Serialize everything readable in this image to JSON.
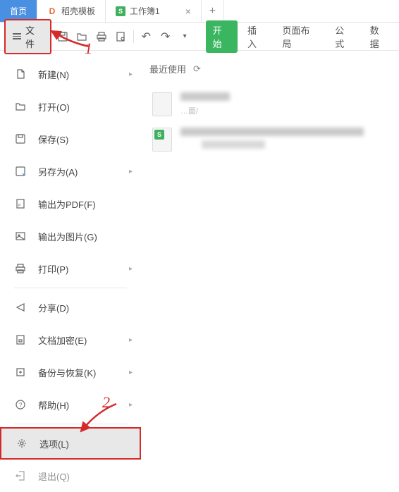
{
  "tabs": {
    "home": "首页",
    "template": "稻壳模板",
    "workbook": "工作簿1"
  },
  "file_button": "文件",
  "ribbon": {
    "start": "开始",
    "insert": "插入",
    "layout": "页面布局",
    "formula": "公式",
    "data": "数据"
  },
  "menu": {
    "new": "新建(N)",
    "open": "打开(O)",
    "save": "保存(S)",
    "save_as": "另存为(A)",
    "export_pdf": "输出为PDF(F)",
    "export_image": "输出为图片(G)",
    "print": "打印(P)",
    "share": "分享(D)",
    "encrypt": "文档加密(E)",
    "backup": "备份与恢复(K)",
    "help": "帮助(H)",
    "options": "选项(L)",
    "exit": "退出(Q)"
  },
  "content": {
    "recent_label": "最近使用",
    "recent_path_suffix": "…面/"
  },
  "annotations": {
    "one": "1",
    "two": "2"
  }
}
